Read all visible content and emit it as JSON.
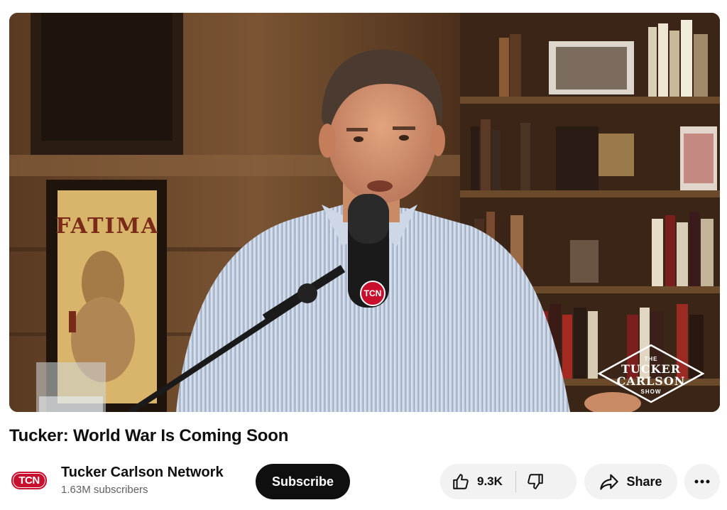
{
  "video": {
    "poster_text": "FATIMA",
    "mic_badge": "TCN",
    "watermark": {
      "line1": "THE",
      "line2": "TUCKER",
      "line3": "CARLSON",
      "line4": "SHOW"
    }
  },
  "title": "Tucker: World War Is Coming Soon",
  "channel": {
    "logo_text": "TCN",
    "name": "Tucker Carlson Network",
    "subscribers": "1.63M subscribers"
  },
  "actions": {
    "subscribe_label": "Subscribe",
    "like_count": "9.3K",
    "share_label": "Share"
  },
  "colors": {
    "accent": "#c8102e",
    "button_bg": "#f2f2f2",
    "subscribe_bg": "#0f0f0f"
  },
  "icons": {
    "like": "thumbs-up-icon",
    "dislike": "thumbs-down-icon",
    "share": "share-arrow-icon",
    "more": "more-horizontal-icon"
  }
}
